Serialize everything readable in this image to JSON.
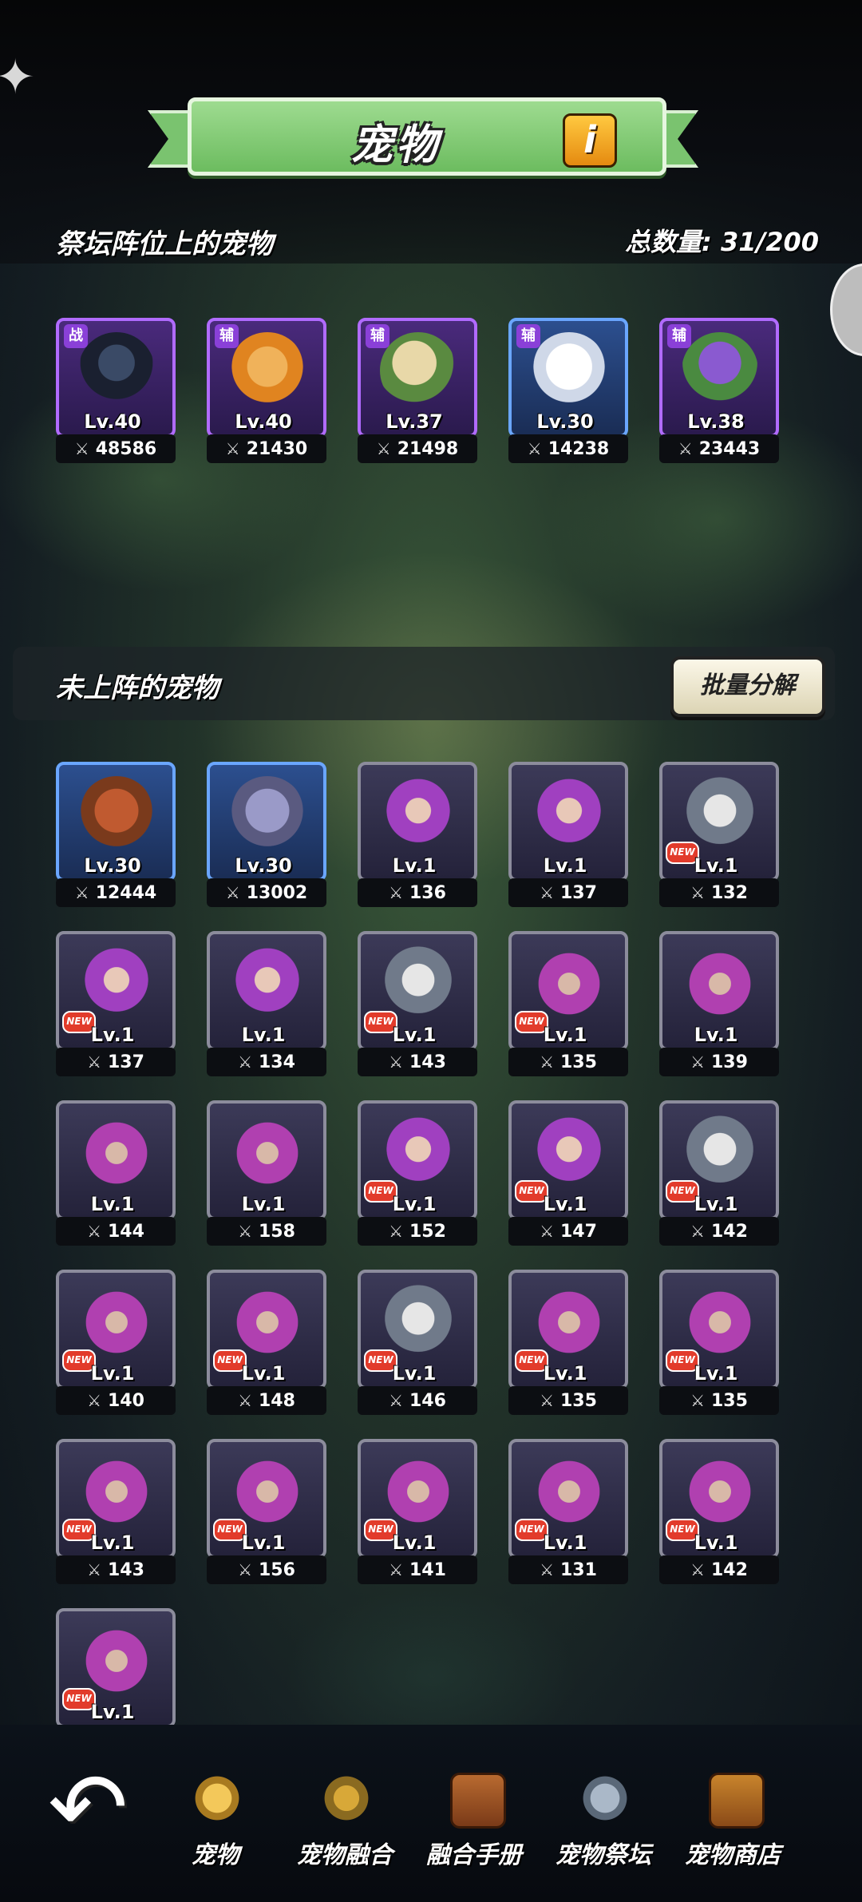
{
  "header": {
    "title": "宠物",
    "info_label": "i"
  },
  "altar_section": {
    "label": "祭坛阵位上的宠物",
    "total_label": "总数量:",
    "total_value": "31/200",
    "pets": [
      {
        "level": "Lv.40",
        "power": "48586",
        "rarity": "purple",
        "art": "armor",
        "role": "战"
      },
      {
        "level": "Lv.40",
        "power": "21430",
        "rarity": "purple",
        "art": "monkey",
        "role": "辅"
      },
      {
        "level": "Lv.37",
        "power": "21498",
        "rarity": "purple",
        "art": "dragon",
        "role": "辅"
      },
      {
        "level": "Lv.30",
        "power": "14238",
        "rarity": "blue",
        "art": "bear",
        "role": "辅"
      },
      {
        "level": "Lv.38",
        "power": "23443",
        "rarity": "purple",
        "art": "plant",
        "role": "辅"
      }
    ]
  },
  "idle_section": {
    "label": "未上阵的宠物",
    "batch_button": "批量分解",
    "new_label": "NEW",
    "pets": [
      {
        "level": "Lv.30",
        "power": "12444",
        "rarity": "blue",
        "art": "ape",
        "new": false
      },
      {
        "level": "Lv.30",
        "power": "13002",
        "rarity": "blue",
        "art": "golem",
        "new": false
      },
      {
        "level": "Lv.1",
        "power": "136",
        "rarity": "gray",
        "art": "mage",
        "new": false
      },
      {
        "level": "Lv.1",
        "power": "137",
        "rarity": "gray",
        "art": "mage",
        "new": false
      },
      {
        "level": "Lv.1",
        "power": "132",
        "rarity": "gray",
        "art": "wolf",
        "new": true
      },
      {
        "level": "Lv.1",
        "power": "137",
        "rarity": "gray",
        "art": "mage",
        "new": true
      },
      {
        "level": "Lv.1",
        "power": "134",
        "rarity": "gray",
        "art": "mage",
        "new": false
      },
      {
        "level": "Lv.1",
        "power": "143",
        "rarity": "gray",
        "art": "wolf",
        "new": true
      },
      {
        "level": "Lv.1",
        "power": "135",
        "rarity": "gray",
        "art": "wizard",
        "new": true
      },
      {
        "level": "Lv.1",
        "power": "139",
        "rarity": "gray",
        "art": "wizard",
        "new": false
      },
      {
        "level": "Lv.1",
        "power": "144",
        "rarity": "gray",
        "art": "wizard",
        "new": false
      },
      {
        "level": "Lv.1",
        "power": "158",
        "rarity": "gray",
        "art": "wizard",
        "new": false
      },
      {
        "level": "Lv.1",
        "power": "152",
        "rarity": "gray",
        "art": "mage",
        "new": true
      },
      {
        "level": "Lv.1",
        "power": "147",
        "rarity": "gray",
        "art": "mage",
        "new": true
      },
      {
        "level": "Lv.1",
        "power": "142",
        "rarity": "gray",
        "art": "wolf",
        "new": true
      },
      {
        "level": "Lv.1",
        "power": "140",
        "rarity": "gray",
        "art": "wizard",
        "new": true
      },
      {
        "level": "Lv.1",
        "power": "148",
        "rarity": "gray",
        "art": "wizard",
        "new": true
      },
      {
        "level": "Lv.1",
        "power": "146",
        "rarity": "gray",
        "art": "wolf",
        "new": true
      },
      {
        "level": "Lv.1",
        "power": "135",
        "rarity": "gray",
        "art": "wizard",
        "new": true
      },
      {
        "level": "Lv.1",
        "power": "135",
        "rarity": "gray",
        "art": "wizard",
        "new": true
      },
      {
        "level": "Lv.1",
        "power": "143",
        "rarity": "gray",
        "art": "wizard",
        "new": true
      },
      {
        "level": "Lv.1",
        "power": "156",
        "rarity": "gray",
        "art": "wizard",
        "new": true
      },
      {
        "level": "Lv.1",
        "power": "141",
        "rarity": "gray",
        "art": "wizard",
        "new": true
      },
      {
        "level": "Lv.1",
        "power": "131",
        "rarity": "gray",
        "art": "wizard",
        "new": true
      },
      {
        "level": "Lv.1",
        "power": "142",
        "rarity": "gray",
        "art": "wizard",
        "new": true
      },
      {
        "level": "Lv.1",
        "power": "",
        "rarity": "gray",
        "art": "wizard",
        "new": true
      }
    ]
  },
  "bottom_nav": {
    "back_icon": "back-arrow-icon",
    "items": [
      {
        "label": "宠物",
        "icon": "pet-bell-icon",
        "active": true
      },
      {
        "label": "宠物融合",
        "icon": "fusion-icon",
        "active": false
      },
      {
        "label": "融合手册",
        "icon": "book-icon",
        "active": false
      },
      {
        "label": "宠物祭坛",
        "icon": "altar-icon",
        "active": false
      },
      {
        "label": "宠物商店",
        "icon": "shop-icon",
        "active": false
      }
    ]
  }
}
